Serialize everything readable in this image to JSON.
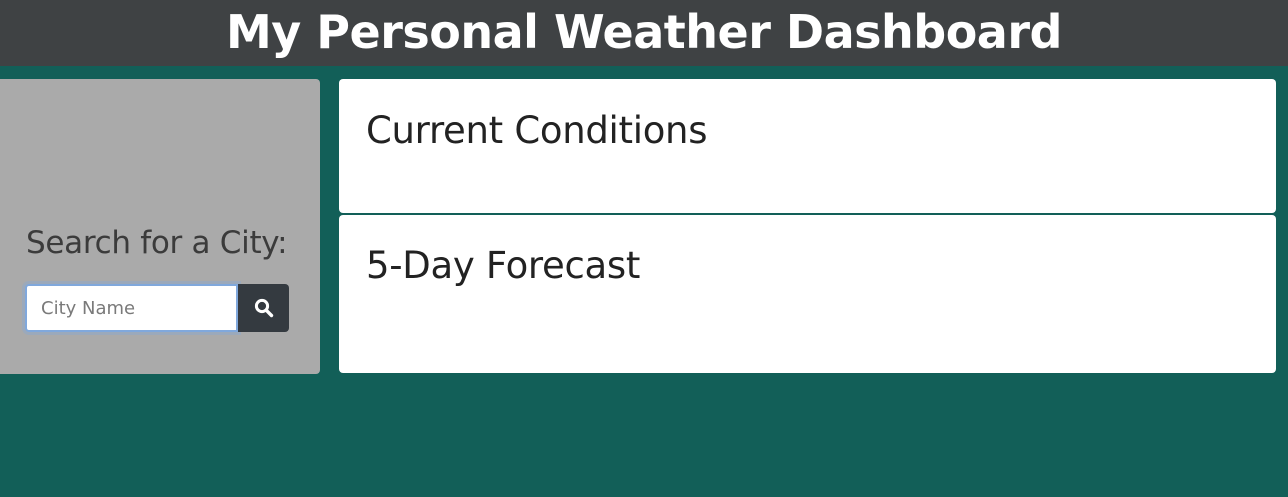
{
  "header": {
    "title": "My Personal Weather Dashboard"
  },
  "sidebar": {
    "label": "Search for a City:",
    "search": {
      "placeholder": "City Name",
      "value": ""
    },
    "search_button_icon": "search-icon"
  },
  "main": {
    "current": {
      "title": "Current Conditions"
    },
    "forecast": {
      "title": "5-Day Forecast"
    }
  },
  "colors": {
    "background": "#125f58",
    "header": "#3f4244",
    "sidebar": "#aaaaaa",
    "button": "#343a40",
    "focus": "#80a8dc"
  }
}
